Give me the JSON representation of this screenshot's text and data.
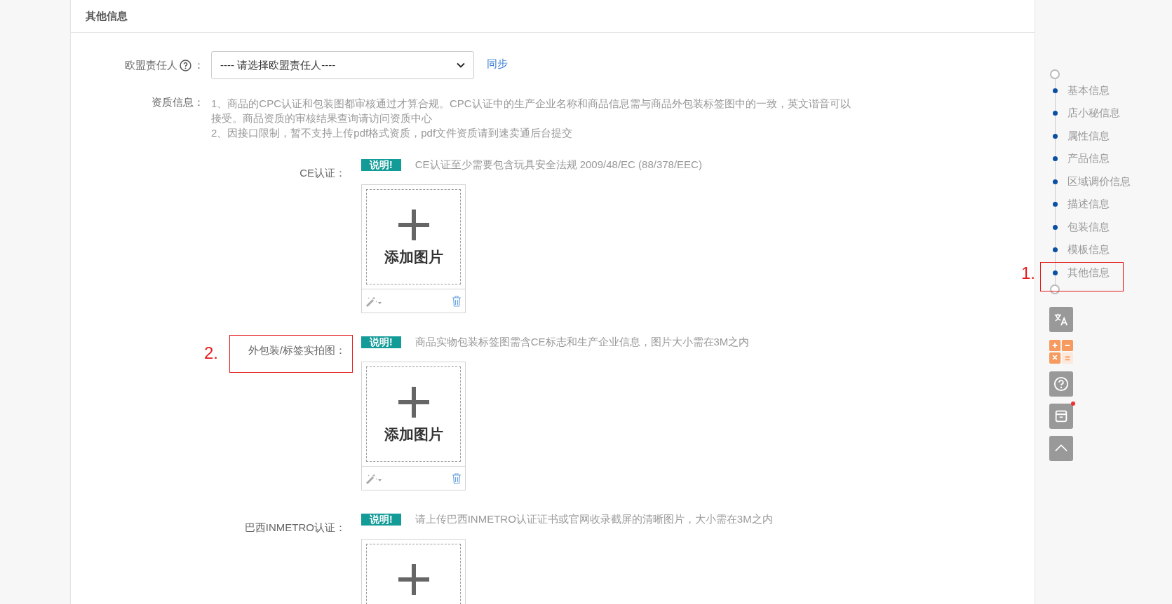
{
  "section": {
    "title": "其他信息"
  },
  "eu_rep": {
    "label": "欧盟责任人",
    "suffix": "：",
    "select": {
      "value": "---- 请选择欧盟责任人----"
    },
    "sync_link": "同步"
  },
  "qualification": {
    "label": "资质信息：",
    "notes": [
      "1、商品的CPC认证和包装图都审核通过才算合规。CPC认证中的生产企业名称和商品信息需与商品外包装标签图中的一致，英文谐音可以接受。商品资质的审核结果查询请访问资质中心",
      "2、因接口限制，暂不支持上传pdf格式资质，pdf文件资质请到速卖通后台提交"
    ]
  },
  "certifications": [
    {
      "label": "CE认证：",
      "badge": "说明!",
      "note": "CE认证至少需要包含玩具安全法规 2009/48/EC (88/378/EEC)",
      "add_text": "添加图片"
    },
    {
      "label": "外包装/标签实拍图：",
      "badge": "说明!",
      "note": "商品实物包装标签图需含CE标志和生产企业信息，图片大小需在3M之内",
      "add_text": "添加图片"
    },
    {
      "label": "巴西INMETRO认证：",
      "badge": "说明!",
      "note": "请上传巴西INMETRO认证证书或官网收录截屏的清晰图片，大小需在3M之内"
    }
  ],
  "side_nav": {
    "items": [
      {
        "label": "基本信息"
      },
      {
        "label": "店小秘信息"
      },
      {
        "label": "属性信息"
      },
      {
        "label": "产品信息"
      },
      {
        "label": "区域调价信息"
      },
      {
        "label": "描述信息"
      },
      {
        "label": "包装信息"
      },
      {
        "label": "模板信息"
      },
      {
        "label": "其他信息"
      }
    ]
  },
  "tools": [
    {
      "kind": "translate",
      "notification": false
    },
    {
      "kind": "calculator",
      "notification": false
    },
    {
      "kind": "help",
      "notification": false
    },
    {
      "kind": "archive",
      "notification": true
    },
    {
      "kind": "top",
      "notification": false
    }
  ],
  "annotations": [
    {
      "number": "1."
    },
    {
      "number": "2."
    }
  ]
}
